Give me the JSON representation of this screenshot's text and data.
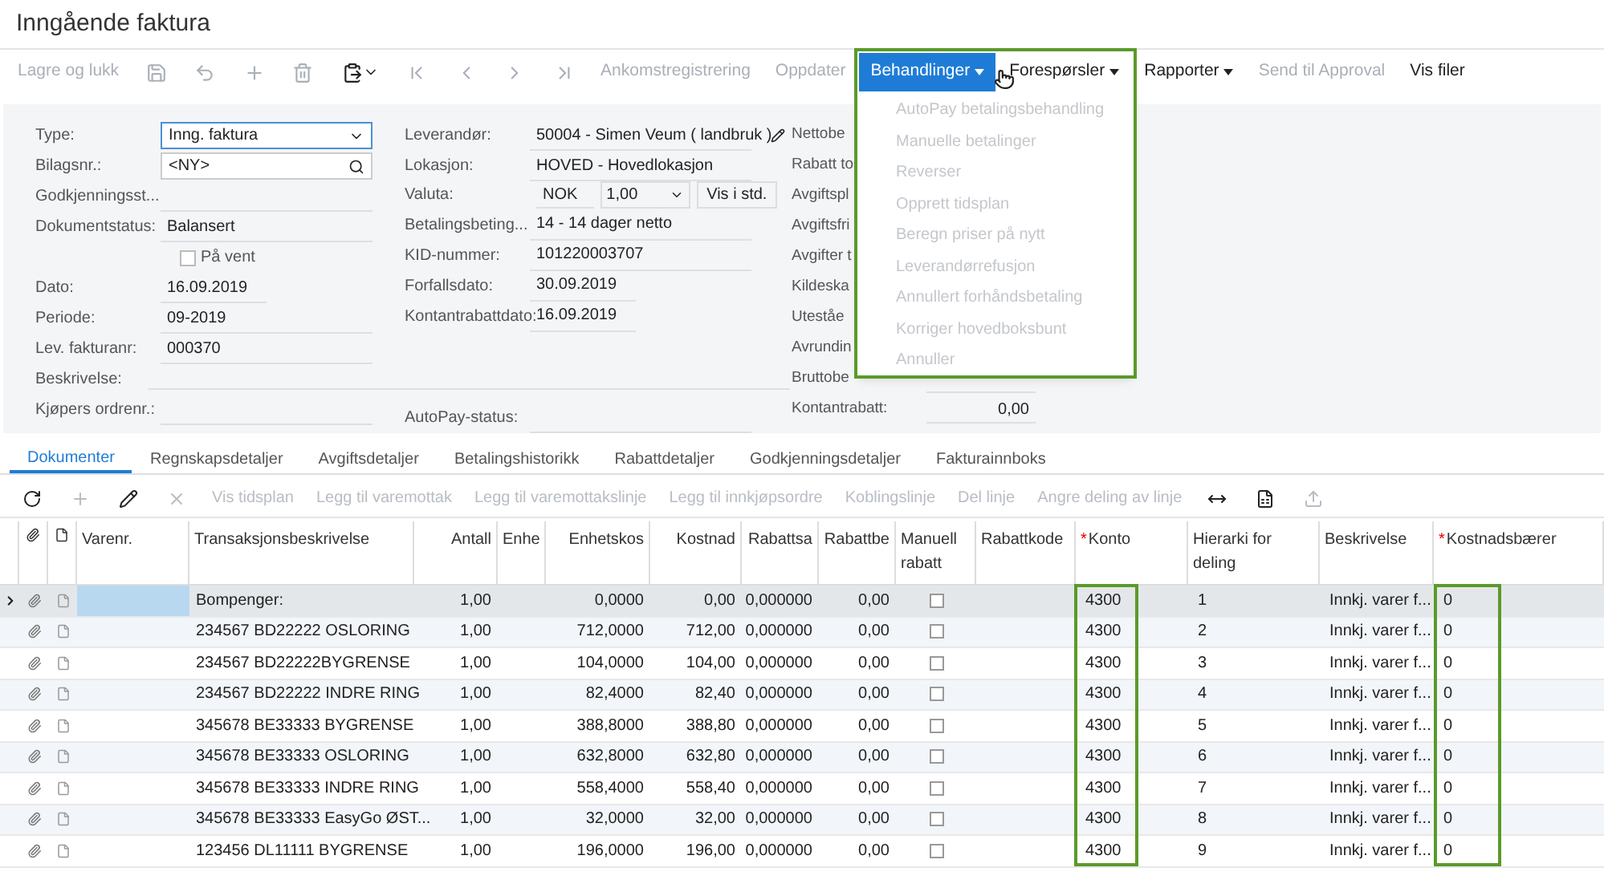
{
  "title": "Inngående faktura",
  "toolbar": [
    {
      "kind": "text",
      "label": "Lagre og lukk",
      "disabled": true
    },
    {
      "kind": "icon",
      "disabled": true
    },
    {
      "kind": "icon",
      "disabled": true
    },
    {
      "kind": "icon",
      "disabled": true
    },
    {
      "kind": "icon",
      "disabled": true
    },
    {
      "kind": "icon",
      "disabled": false
    },
    {
      "kind": "icon",
      "disabled": true
    },
    {
      "kind": "icon",
      "disabled": true
    },
    {
      "kind": "icon",
      "disabled": true
    },
    {
      "kind": "icon",
      "disabled": true
    },
    {
      "kind": "text",
      "label": "Ankomstregistrering",
      "disabled": true
    },
    {
      "kind": "text",
      "label": "Oppdater",
      "disabled": true
    },
    {
      "kind": "menu",
      "label": "Behandlinger",
      "disabled": false,
      "selected": true
    },
    {
      "kind": "menu",
      "label": "Forespørsler",
      "disabled": false,
      "selected": false
    },
    {
      "kind": "menu",
      "label": "Rapporter",
      "disabled": false,
      "selected": false
    },
    {
      "kind": "text",
      "label": "Send til Approval",
      "disabled": true
    },
    {
      "kind": "text",
      "label": "Vis filer",
      "disabled": false
    }
  ],
  "menu_items": [
    {
      "label": "AutoPay betalingsbehandling",
      "disabled": true
    },
    {
      "label": "Manuelle betalinger",
      "disabled": true
    },
    {
      "label": "Reverser",
      "disabled": true
    },
    {
      "label": "Opprett tidsplan",
      "disabled": true
    },
    {
      "label": "Beregn priser på nytt",
      "disabled": true
    },
    {
      "label": "Leverandørrefusjon",
      "disabled": true
    },
    {
      "label": "Annullert forhåndsbetaling",
      "disabled": true
    },
    {
      "label": "Korriger hovedboksbunt",
      "disabled": true
    },
    {
      "label": "Annuller",
      "disabled": true
    }
  ],
  "form_left": [
    {
      "kind": "select",
      "label": "Type:",
      "value": "Inng. faktura"
    },
    {
      "kind": "search",
      "label": "Bilagsnr.:",
      "value": "<NY>"
    },
    {
      "kind": "text",
      "label": "Godkjenningsst..."
    },
    {
      "kind": "text",
      "label": "Dokumentstatus:",
      "value": "Balansert"
    },
    {
      "kind": "checkbox",
      "label": "På vent",
      "checked": false
    },
    {
      "kind": "short",
      "label": "Dato:",
      "value": "16.09.2019"
    },
    {
      "kind": "text",
      "label": "Periode:",
      "value": "09-2019"
    },
    {
      "kind": "text",
      "label": "Lev. fakturanr:",
      "value": "000370"
    }
  ],
  "form_mid": [
    {
      "kind": "text",
      "label": "Leverandør:",
      "value": "50004 - Simen Veum ( landbruk )"
    },
    {
      "kind": "text",
      "label": "Lokasjon:",
      "value": "HOVED - Hovedlokasjon"
    },
    {
      "kind": "currency",
      "label": "Valuta:",
      "value": "NOK",
      "rate": "1,00",
      "button": "Vis i std."
    },
    {
      "kind": "text",
      "label": "Betalingsbeting...",
      "value": "14 - 14 dager netto"
    },
    {
      "kind": "text",
      "label": "KID-nummer:",
      "value": "101220003707"
    },
    {
      "kind": "short",
      "label": "Forfallsdato:",
      "value": "30.09.2019"
    },
    {
      "kind": "short",
      "label": "Kontantrabattdato:",
      "value": "16.09.2019"
    }
  ],
  "description": {
    "label": "Beskrivelse:"
  },
  "buyer_order": {
    "label": "Kjøpers ordrenr.:"
  },
  "autopay": {
    "label": "AutoPay-status:"
  },
  "summary": [
    {
      "label": "Nettobe"
    },
    {
      "label": "Rabatt to"
    },
    {
      "label": "Avgiftspl"
    },
    {
      "label": "Avgiftsfri"
    },
    {
      "label": "Avgifter t"
    },
    {
      "label": "Kildeska"
    },
    {
      "label": "Uteståe"
    },
    {
      "label": "Avrundin"
    },
    {
      "label": "Bruttobe"
    },
    {
      "label": "Kontantrabatt:",
      "value": "0,00"
    }
  ],
  "tabs": [
    {
      "label": "Dokumenter",
      "selected": true
    },
    {
      "label": "Regnskapsdetaljer",
      "selected": false
    },
    {
      "label": "Avgiftsdetaljer",
      "selected": false
    },
    {
      "label": "Betalingshistorikk",
      "selected": false
    },
    {
      "label": "Rabattdetaljer",
      "selected": false
    },
    {
      "label": "Godkjenningsdetaljer",
      "selected": false
    },
    {
      "label": "Fakturainnboks",
      "selected": false
    }
  ],
  "grid_toolbar": [
    {
      "kind": "icon",
      "disabled": false
    },
    {
      "kind": "icon",
      "disabled": true
    },
    {
      "kind": "icon",
      "disabled": false
    },
    {
      "kind": "icon",
      "disabled": true
    },
    {
      "kind": "text",
      "label": "Vis tidsplan",
      "disabled": true
    },
    {
      "kind": "text",
      "label": "Legg til varemottak",
      "disabled": true
    },
    {
      "kind": "text",
      "label": "Legg til varemottakslinje",
      "disabled": true
    },
    {
      "kind": "text",
      "label": "Legg til innkjøpsordre",
      "disabled": true
    },
    {
      "kind": "text",
      "label": "Koblingslinje",
      "disabled": true
    },
    {
      "kind": "text",
      "label": "Del linje",
      "disabled": true
    },
    {
      "kind": "text",
      "label": "Angre deling av linje",
      "disabled": true
    },
    {
      "kind": "icon",
      "disabled": false
    },
    {
      "kind": "icon",
      "disabled": false
    },
    {
      "kind": "icon",
      "disabled": true
    }
  ],
  "table": {
    "columns": [
      {
        "label": "Varenr."
      },
      {
        "label": "Transaksjonsbeskrivelse"
      },
      {
        "label": "Antall"
      },
      {
        "label": "Enhe"
      },
      {
        "label": "Enhetskos"
      },
      {
        "label": "Kostnad"
      },
      {
        "label": "Rabattsa"
      },
      {
        "label": "Rabattbe"
      },
      {
        "label": "Manuell rabatt"
      },
      {
        "label": "Rabattkode"
      },
      {
        "label": "Konto",
        "marker": "*"
      },
      {
        "label": "Hierarki for deling"
      },
      {
        "label": "Beskrivelse"
      },
      {
        "label": "Kostnadsbærer",
        "marker": "*"
      }
    ],
    "rows": [
      {
        "selected": true,
        "description": "Bompenger:",
        "qty": "1,00",
        "unit_cost": "0,0000",
        "cost": "0,00",
        "disc_pct": "0,000000",
        "disc_amt": "0,00",
        "manual": false,
        "account": "4300",
        "hierarchy": "1",
        "desc2": "Innkj. varer f...",
        "cost_center": "0"
      },
      {
        "selected": false,
        "description": "234567 BD22222 OSLORING",
        "qty": "1,00",
        "unit_cost": "712,0000",
        "cost": "712,00",
        "disc_pct": "0,000000",
        "disc_amt": "0,00",
        "manual": false,
        "account": "4300",
        "hierarchy": "2",
        "desc2": "Innkj. varer f...",
        "cost_center": "0"
      },
      {
        "selected": false,
        "description": "234567 BD22222BYGRENSE",
        "qty": "1,00",
        "unit_cost": "104,0000",
        "cost": "104,00",
        "disc_pct": "0,000000",
        "disc_amt": "0,00",
        "manual": false,
        "account": "4300",
        "hierarchy": "3",
        "desc2": "Innkj. varer f...",
        "cost_center": "0"
      },
      {
        "selected": false,
        "description": "234567 BD22222 INDRE RING",
        "qty": "1,00",
        "unit_cost": "82,4000",
        "cost": "82,40",
        "disc_pct": "0,000000",
        "disc_amt": "0,00",
        "manual": false,
        "account": "4300",
        "hierarchy": "4",
        "desc2": "Innkj. varer f...",
        "cost_center": "0"
      },
      {
        "selected": false,
        "description": "345678 BE33333 BYGRENSE",
        "qty": "1,00",
        "unit_cost": "388,8000",
        "cost": "388,80",
        "disc_pct": "0,000000",
        "disc_amt": "0,00",
        "manual": false,
        "account": "4300",
        "hierarchy": "5",
        "desc2": "Innkj. varer f...",
        "cost_center": "0"
      },
      {
        "selected": false,
        "description": "345678 BE33333 OSLORING",
        "qty": "1,00",
        "unit_cost": "632,8000",
        "cost": "632,80",
        "disc_pct": "0,000000",
        "disc_amt": "0,00",
        "manual": false,
        "account": "4300",
        "hierarchy": "6",
        "desc2": "Innkj. varer f...",
        "cost_center": "0"
      },
      {
        "selected": false,
        "description": "345678 BE33333 INDRE RING",
        "qty": "1,00",
        "unit_cost": "558,4000",
        "cost": "558,40",
        "disc_pct": "0,000000",
        "disc_amt": "0,00",
        "manual": false,
        "account": "4300",
        "hierarchy": "7",
        "desc2": "Innkj. varer f...",
        "cost_center": "0"
      },
      {
        "selected": false,
        "description": "345678 BE33333 EasyGo ØST...",
        "qty": "1,00",
        "unit_cost": "32,0000",
        "cost": "32,00",
        "disc_pct": "0,000000",
        "disc_amt": "0,00",
        "manual": false,
        "account": "4300",
        "hierarchy": "8",
        "desc2": "Innkj. varer f...",
        "cost_center": "0"
      },
      {
        "selected": false,
        "description": "123456 DL11111 BYGRENSE",
        "qty": "1,00",
        "unit_cost": "196,0000",
        "cost": "196,00",
        "disc_pct": "0,000000",
        "disc_amt": "0,00",
        "manual": false,
        "account": "4300",
        "hierarchy": "9",
        "desc2": "Innkj. varer f...",
        "cost_center": "0"
      }
    ]
  }
}
